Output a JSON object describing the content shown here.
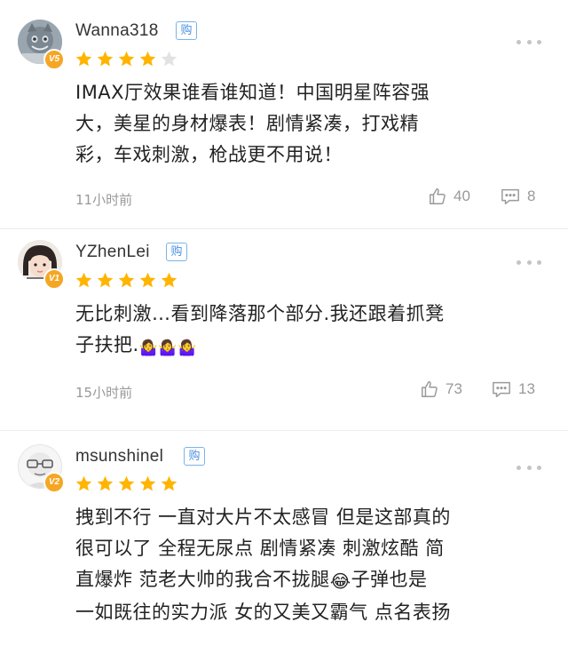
{
  "comments": [
    {
      "username": "Wanna318",
      "buy_badge": "购",
      "level": "V5",
      "rating": 4,
      "text_lines": [
        "IMAX厅效果谁看谁知道！中国明星阵容强",
        "大，美星的身材爆表！剧情紧凑，打戏精",
        "彩，车戏刺激，枪战更不用说！"
      ],
      "time": "11小时前",
      "likes": "40",
      "replies": "8"
    },
    {
      "username": "YZhenLei",
      "buy_badge": "购",
      "level": "V1",
      "rating": 5,
      "text_lines": [
        "无比刺激…看到降落那个部分.我还跟着抓凳",
        "子扶把."
      ],
      "emoji": "🤷‍♀️🤷‍♀️🤷‍♀️",
      "time": "15小时前",
      "likes": "73",
      "replies": "13"
    },
    {
      "username": "msunshinel",
      "buy_badge": "购",
      "level": "V2",
      "rating": 5,
      "text_lines": [
        "拽到不行 一直对大片不太感冒 但是这部真的",
        "很可以了 全程无尿点 剧情紧凑 刺激炫酷 简",
        "直爆炸 范老大帅的我合不拢腿",
        "一如既往的实力派 女的又美又霸气 点名表扬"
      ],
      "line3_tail": "子弹也是",
      "emoji": "😂"
    }
  ],
  "colors": {
    "star": "#ffb400",
    "star_empty": "#e2e2e2",
    "buy_badge": "#4a90e2",
    "level_badge": "#f5a623"
  },
  "icons": {
    "like": "thumbs-up-icon",
    "reply": "comment-icon",
    "more": "more-dots-icon"
  }
}
